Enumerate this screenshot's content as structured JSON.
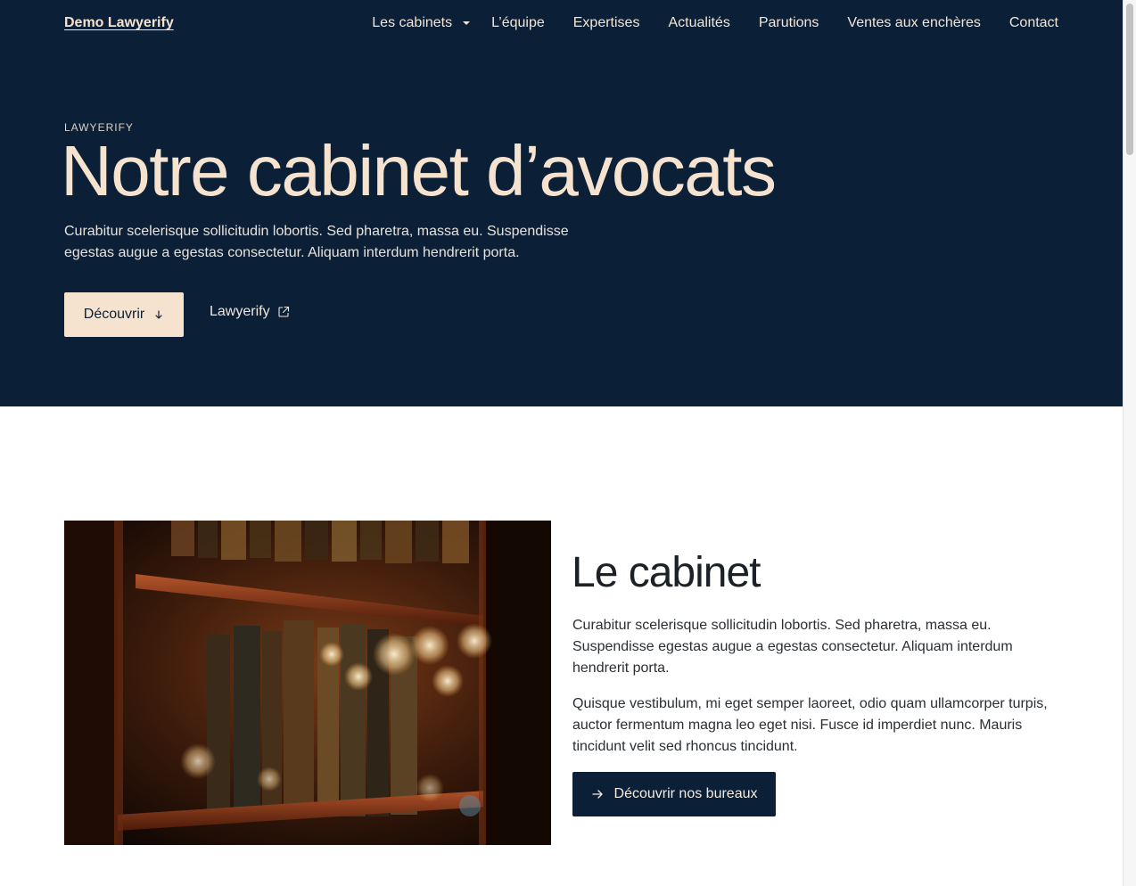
{
  "header": {
    "brand": "Demo Lawyerify",
    "nav": [
      {
        "label": "Les cabinets",
        "has_dropdown": true
      },
      {
        "label": "L’équipe"
      },
      {
        "label": "Expertises"
      },
      {
        "label": "Actualités"
      },
      {
        "label": "Parutions"
      },
      {
        "label": "Ventes aux enchères"
      },
      {
        "label": "Contact"
      }
    ]
  },
  "hero": {
    "kicker": "LAWYERIFY",
    "title": "Notre cabinet d’avocats",
    "text": "Curabitur scelerisque sollicitudin lobortis. Sed pharetra, massa eu. Suspendisse egestas augue a egestas consectetur. Aliquam interdum hendrerit porta.",
    "primary_button": "Découvrir",
    "external_link": "Lawyerify"
  },
  "cabinet": {
    "title": "Le cabinet",
    "paragraphs": [
      "Curabitur scelerisque sollicitudin lobortis. Sed pharetra, massa eu. Suspendisse egestas augue a egestas consectetur. Aliquam interdum hendrerit porta.",
      "Quisque vestibulum, mi eget semper laoreet, odio quam ullamcorper turpis, auctor fermentum magna leo eget nisi. Fusce id imperdiet nunc. Mauris tincidunt velit sed rhoncus tincidunt."
    ],
    "button": "Découvrir nos bureaux",
    "image_icon": "bookshelf-photo"
  },
  "colors": {
    "navy": "#0b1f36",
    "cream": "#f6e3cf"
  },
  "icons": {
    "dropdown": "chevron-down-icon",
    "primary_button": "arrow-down-icon",
    "external_link": "external-link-icon",
    "cabinet_button": "arrow-right-icon"
  }
}
